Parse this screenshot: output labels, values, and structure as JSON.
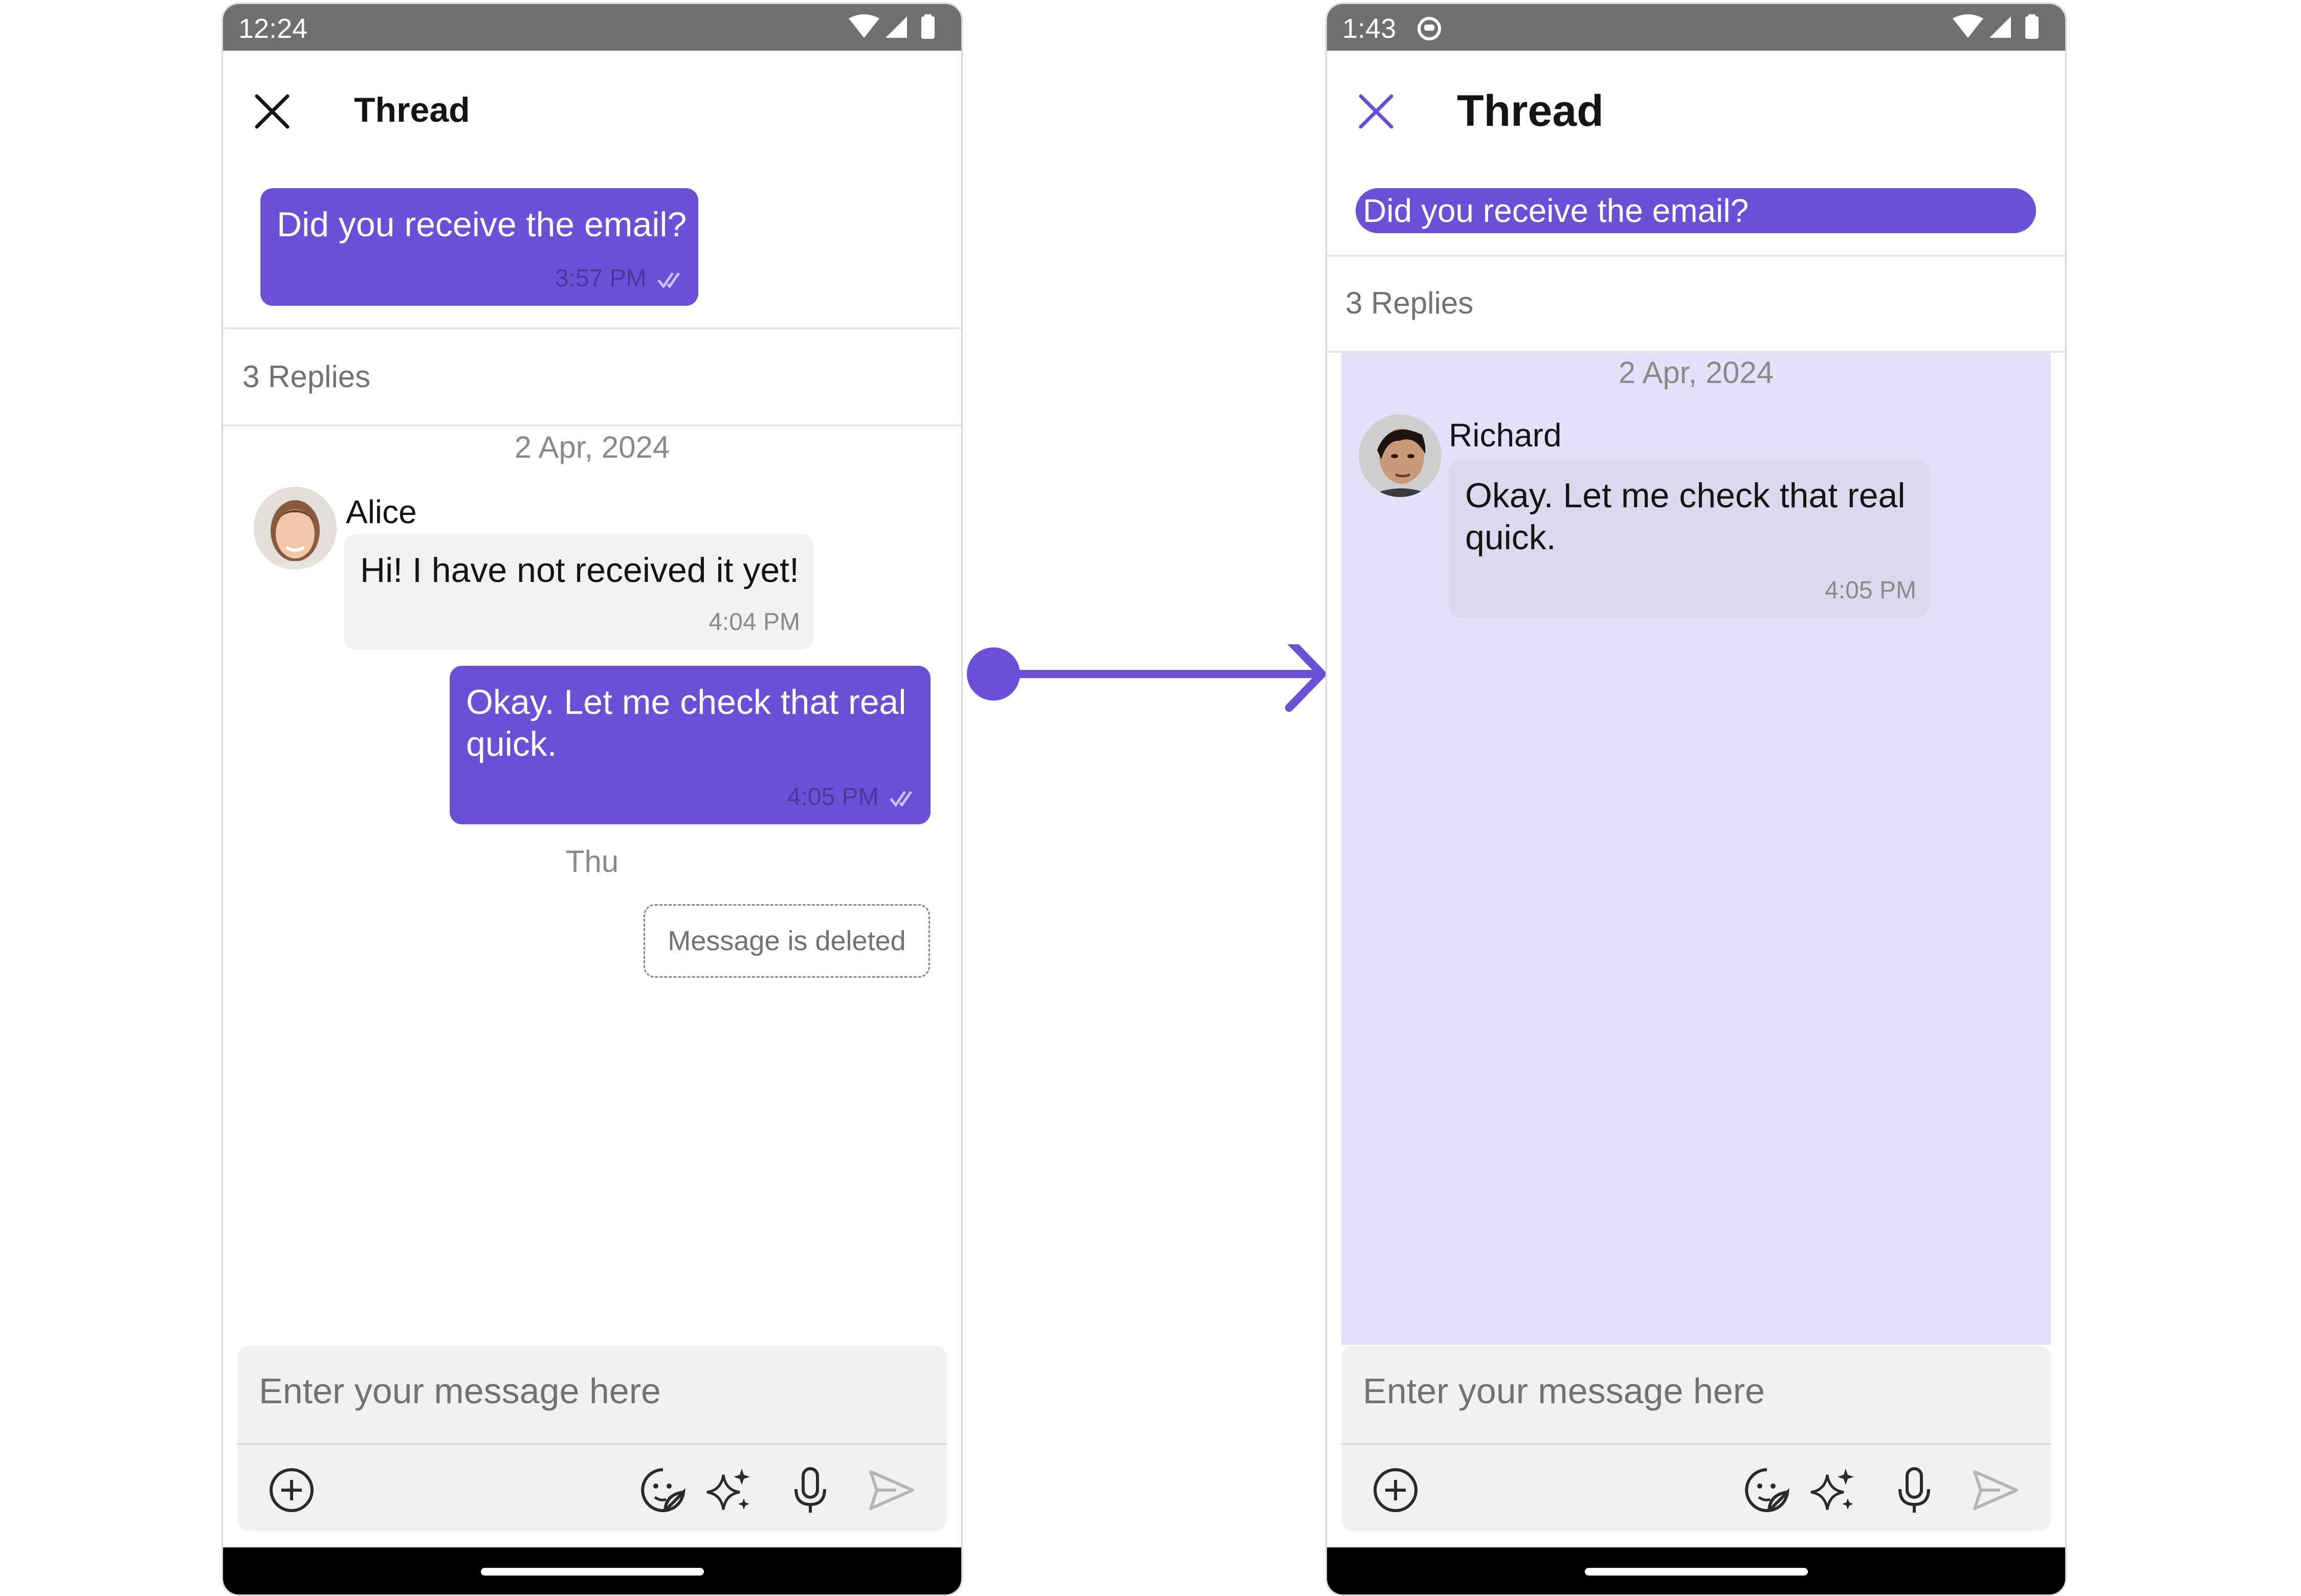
{
  "left_screen": {
    "status": {
      "time": "12:24"
    },
    "header": {
      "title": "Thread"
    },
    "parent_message": {
      "text": "Did you receive the email?",
      "time": "3:57 PM"
    },
    "replies_label": "3 Replies",
    "date_separator_1": "2 Apr, 2024",
    "messages": [
      {
        "sender": "Alice",
        "text": "Hi! I have not received it yet!",
        "time": "4:04 PM"
      },
      {
        "text_line1": "Okay. Let me check that real",
        "text_line2": "quick.",
        "time": "4:05 PM"
      }
    ],
    "date_separator_2": "Thu",
    "deleted_message": "Message is deleted",
    "composer": {
      "placeholder": "Enter your message here"
    }
  },
  "right_screen": {
    "status": {
      "time": "1:43"
    },
    "header": {
      "title": "Thread"
    },
    "parent_message": {
      "text": "Did you receive the email?"
    },
    "replies_label": "3 Replies",
    "date_separator": "2 Apr, 2024",
    "message": {
      "sender": "Richard",
      "text_line1": "Okay. Let me check that real",
      "text_line2": "quick.",
      "time": "4:05 PM"
    },
    "composer": {
      "placeholder": "Enter your message here"
    }
  },
  "colors": {
    "primary": "#6851d6",
    "highlight_background": "#e6e1fb",
    "incoming_bubble": "#f2f2f2",
    "status_bar": "#6f6f6f"
  },
  "icons": [
    "close-icon",
    "wifi-icon",
    "signal-icon",
    "battery-icon",
    "read-receipt-icon",
    "add-attachment-icon",
    "sticker-icon",
    "ai-sparkle-icon",
    "microphone-icon",
    "send-icon",
    "app-notification-icon"
  ]
}
